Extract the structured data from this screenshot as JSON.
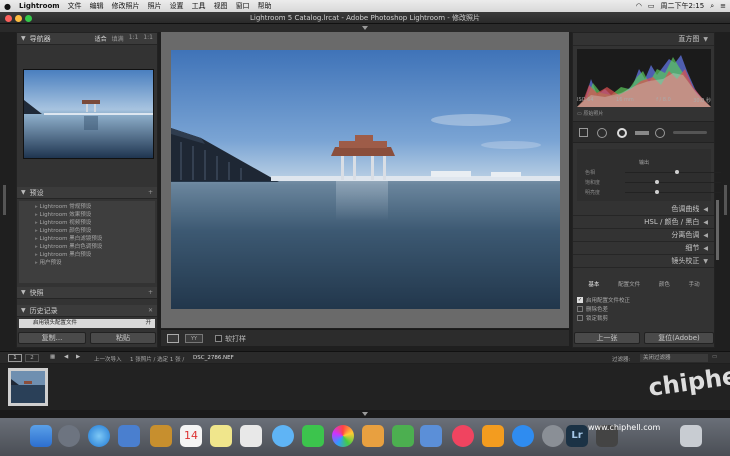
{
  "menubar": {
    "apple": "",
    "app": "Lightroom",
    "items": [
      "文件",
      "编辑",
      "修改照片",
      "照片",
      "设置",
      "工具",
      "视图",
      "窗口",
      "帮助"
    ],
    "clock": "周二下午2:15"
  },
  "window": {
    "title": "Lightroom 5 Catalog.lrcat - Adobe Photoshop Lightroom - 修改照片"
  },
  "left": {
    "navigator": {
      "title": "导航器",
      "zoom": [
        "适合",
        "填满",
        "1:1",
        "1:1"
      ]
    },
    "presets": {
      "title": "预设",
      "items": [
        "Lightroom 常规预设",
        "Lightroom 效果预设",
        "Lightroom 视频预设",
        "Lightroom 颜色预设",
        "Lightroom 黑白滤镜预设",
        "Lightroom 黑白色调预设",
        "Lightroom 黑白预设",
        "用户预设"
      ]
    },
    "snapshots": {
      "title": "快照"
    },
    "history": {
      "title": "历史记录",
      "entry": "启用镜头配置文件",
      "entry_value": "开"
    },
    "copy_button": "复制...",
    "paste_button": "粘贴"
  },
  "toolbar": {
    "softproof": "软打样"
  },
  "right": {
    "histogram": {
      "title": "直方图",
      "iso": "ISO 64",
      "focal": "16 mm",
      "aperture": "f / 8.0",
      "shutter": "30.0 秒",
      "original_photo": "原始照片"
    },
    "hsl_title": "输出",
    "split_labels": [
      "色相",
      "饱和度",
      "明亮度"
    ],
    "sections": [
      "色调曲线",
      "HSL / 颜色 / 黑白",
      "分离色调",
      "细节",
      "镜头校正"
    ],
    "lens_tabs": [
      "基本",
      "配置文件",
      "颜色",
      "手动"
    ],
    "lens_checks": [
      "启用配置文件校正",
      "删除色差",
      "锁定裁剪"
    ],
    "prev_button": "上一张",
    "reset_button": "复位(Adobe)"
  },
  "filmstrip_bar": {
    "page1": "1",
    "page2": "2",
    "info": "上一次导入",
    "count": "1 张照片 / 选定 1 张 /",
    "filename": "DSC_2786.NEF",
    "filter_label": "过滤器:",
    "filter_value": "关闭过滤器"
  },
  "watermark": {
    "site": "www.chiphell.com",
    "logo": "chiphell"
  },
  "colors": {
    "accent": "#e8e8e8",
    "panel": "#333333",
    "background": "#1f1f1f"
  },
  "dock": {
    "icons": [
      "finder-icon",
      "launchpad-icon",
      "safari-icon",
      "preview-icon",
      "notes-icon",
      "calendar-icon",
      "stickies-icon",
      "photos-icon",
      "messages-icon",
      "facetime-icon",
      "itunes-photos-icon",
      "sketch-icon",
      "numbers-icon",
      "keynote-icon",
      "music-icon",
      "books-icon",
      "appstore-icon",
      "settings-icon",
      "lightroom-icon",
      "other-icon",
      "trash-icon"
    ],
    "calendar_day": "14"
  }
}
